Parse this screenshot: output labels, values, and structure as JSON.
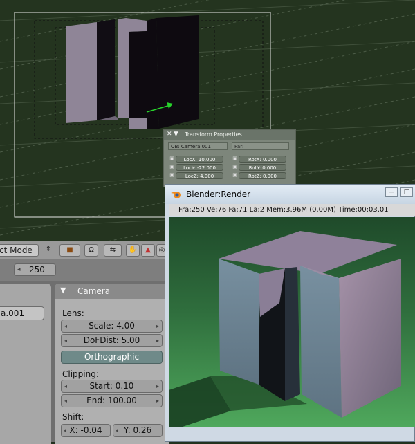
{
  "transform_panel": {
    "title": "Transform Properties",
    "ob_field": "OB: Camera.001",
    "par_field": "Par:",
    "locx": "LocX: 10.000",
    "locy": "LocY: -22.000",
    "locz": "LocZ: 4.000",
    "rotx": "RotX: 0.000",
    "roty": "RotY: 0.000",
    "rotz": "RotZ: 0.000"
  },
  "toolbar": {
    "mode_label": "ct Mode"
  },
  "frame": {
    "value": "250"
  },
  "left_panel": {
    "object_name": "a.001"
  },
  "camera_panel": {
    "title": "Camera",
    "lens_label": "Lens:",
    "scale": "Scale: 4.00",
    "dof": "DoFDist: 5.00",
    "ortho": "Orthographic",
    "clipping_label": "Clipping:",
    "start": "Start: 0.10",
    "end": "End: 100.00",
    "shift_label": "Shift:",
    "shift_x": "X: -0.04",
    "shift_y": "Y: 0.26"
  },
  "render_window": {
    "title": "Blender:Render",
    "info": "Fra:250  Ve:76 Fa:71  La:2 Mem:3.96M (0.00M) Time:00:03.01"
  },
  "colors": {
    "viewport_bg": "#24341f",
    "render_sky": "#2f6e3d",
    "object_face": "#8f8597"
  }
}
